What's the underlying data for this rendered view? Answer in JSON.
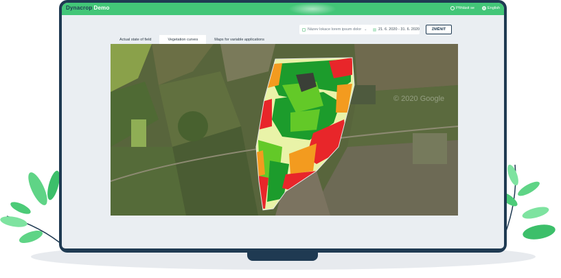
{
  "app": {
    "brand_name": "Dynacrop",
    "brand_suffix": "Demo",
    "user_label": "Přihlásit se",
    "language_label": "English"
  },
  "filters": {
    "location_value": "Název lokace lorem ipsum dolor",
    "date_range": "21. 6. 2020 - 31. 6. 2020",
    "change_button": "ZMĚNIT"
  },
  "tabs": [
    {
      "label": "Actual state of field",
      "active": false
    },
    {
      "label": "Vegetation curves",
      "active": true
    },
    {
      "label": "Maps for variable applications",
      "active": false
    }
  ],
  "map": {
    "watermark": "© 2020 Google",
    "zone_colors": {
      "high": "#1c9c2c",
      "medium_high": "#63c928",
      "medium": "#e9f3a8",
      "low": "#f39b1f",
      "very_low": "#e8262a"
    }
  },
  "colors": {
    "topbar": "#43c678",
    "monitor": "#1f3a52",
    "screen": "#eaeef2"
  }
}
